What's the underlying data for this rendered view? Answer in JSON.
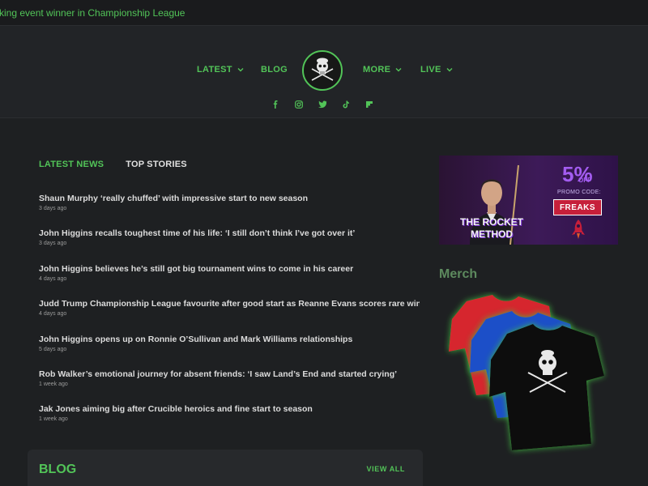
{
  "ticker": {
    "text": "king event winner in Championship League"
  },
  "nav": {
    "latest": "LATEST",
    "blog": "BLOG",
    "more": "MORE",
    "live": "LIVE"
  },
  "socials": [
    "facebook-icon",
    "instagram-icon",
    "twitter-icon",
    "tiktok-icon",
    "flipboard-icon"
  ],
  "tabs": {
    "latest_news": "LATEST NEWS",
    "top_stories": "TOP STORIES"
  },
  "news": [
    {
      "title": "Shaun Murphy ‘really chuffed’ with impressive start to new season",
      "time": "3 days ago"
    },
    {
      "title": "John Higgins recalls toughest time of his life: ‘I still don’t think I’ve got over it’",
      "time": "3 days ago"
    },
    {
      "title": "John Higgins believes he’s still got big tournament wins to come in his career",
      "time": "4 days ago"
    },
    {
      "title": "Judd Trump Championship League favourite after good start as Reanne Evans scores rare win",
      "time": "4 days ago"
    },
    {
      "title": "John Higgins opens up on Ronnie O’Sullivan and Mark Williams relationships",
      "time": "5 days ago"
    },
    {
      "title": "Rob Walker’s emotional journey for absent friends: ‘I saw Land’s End and started crying’",
      "time": "1 week ago"
    },
    {
      "title": "Jak Jones aiming big after Crucible heroics and fine start to season",
      "time": "1 week ago"
    }
  ],
  "blog": {
    "title": "BLOG",
    "view_all": "VIEW ALL"
  },
  "ad": {
    "headline_line1": "THE ROCKET",
    "headline_line2": "METHOD",
    "percent": "5%",
    "off": "OFF",
    "promo_label": "PROMO CODE:",
    "promo_code": "FREAKS"
  },
  "merch": {
    "heading": "Merch"
  },
  "colors": {
    "accent": "#52c458",
    "background": "#1e2022",
    "header": "#222427",
    "ad_purple": "#a35cf0",
    "ad_red": "#c61f3a"
  }
}
